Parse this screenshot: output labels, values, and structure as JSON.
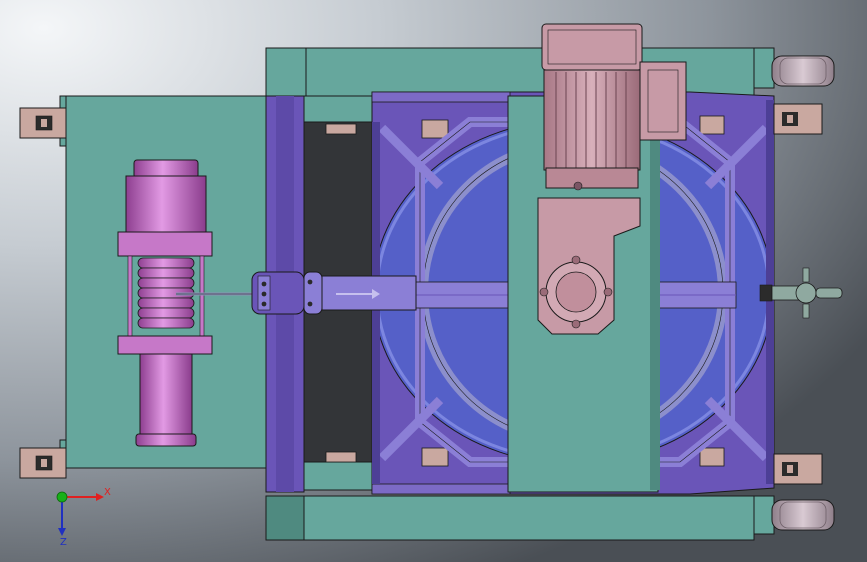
{
  "viewport": {
    "background_gradient": [
      "#f4f6f8",
      "#c6ccd2",
      "#8d949c",
      "#4a4f55"
    ]
  },
  "colors": {
    "teal": "#66a79d",
    "teal_dark": "#4f8a80",
    "edge": "#1a1a1a",
    "purple": "#6a55b8",
    "purple_light": "#8b7fd6",
    "blue_disc": "#5560c8",
    "pink": "#c678c8",
    "motor": "#c79aa6",
    "motor_dark": "#9a6b78",
    "wheel": "#b8a7b2",
    "lug": "#c9a8a0",
    "gray_rod": "#8a90b4",
    "axis_x": "#e02020",
    "axis_y": "#18b018",
    "axis_z": "#2030c0"
  },
  "triad": {
    "x_label": "X",
    "z_label": "Z",
    "x_icon": "x-axis-arrow-icon",
    "y_icon": "y-axis-dot-icon",
    "z_icon": "z-axis-arrow-icon"
  }
}
